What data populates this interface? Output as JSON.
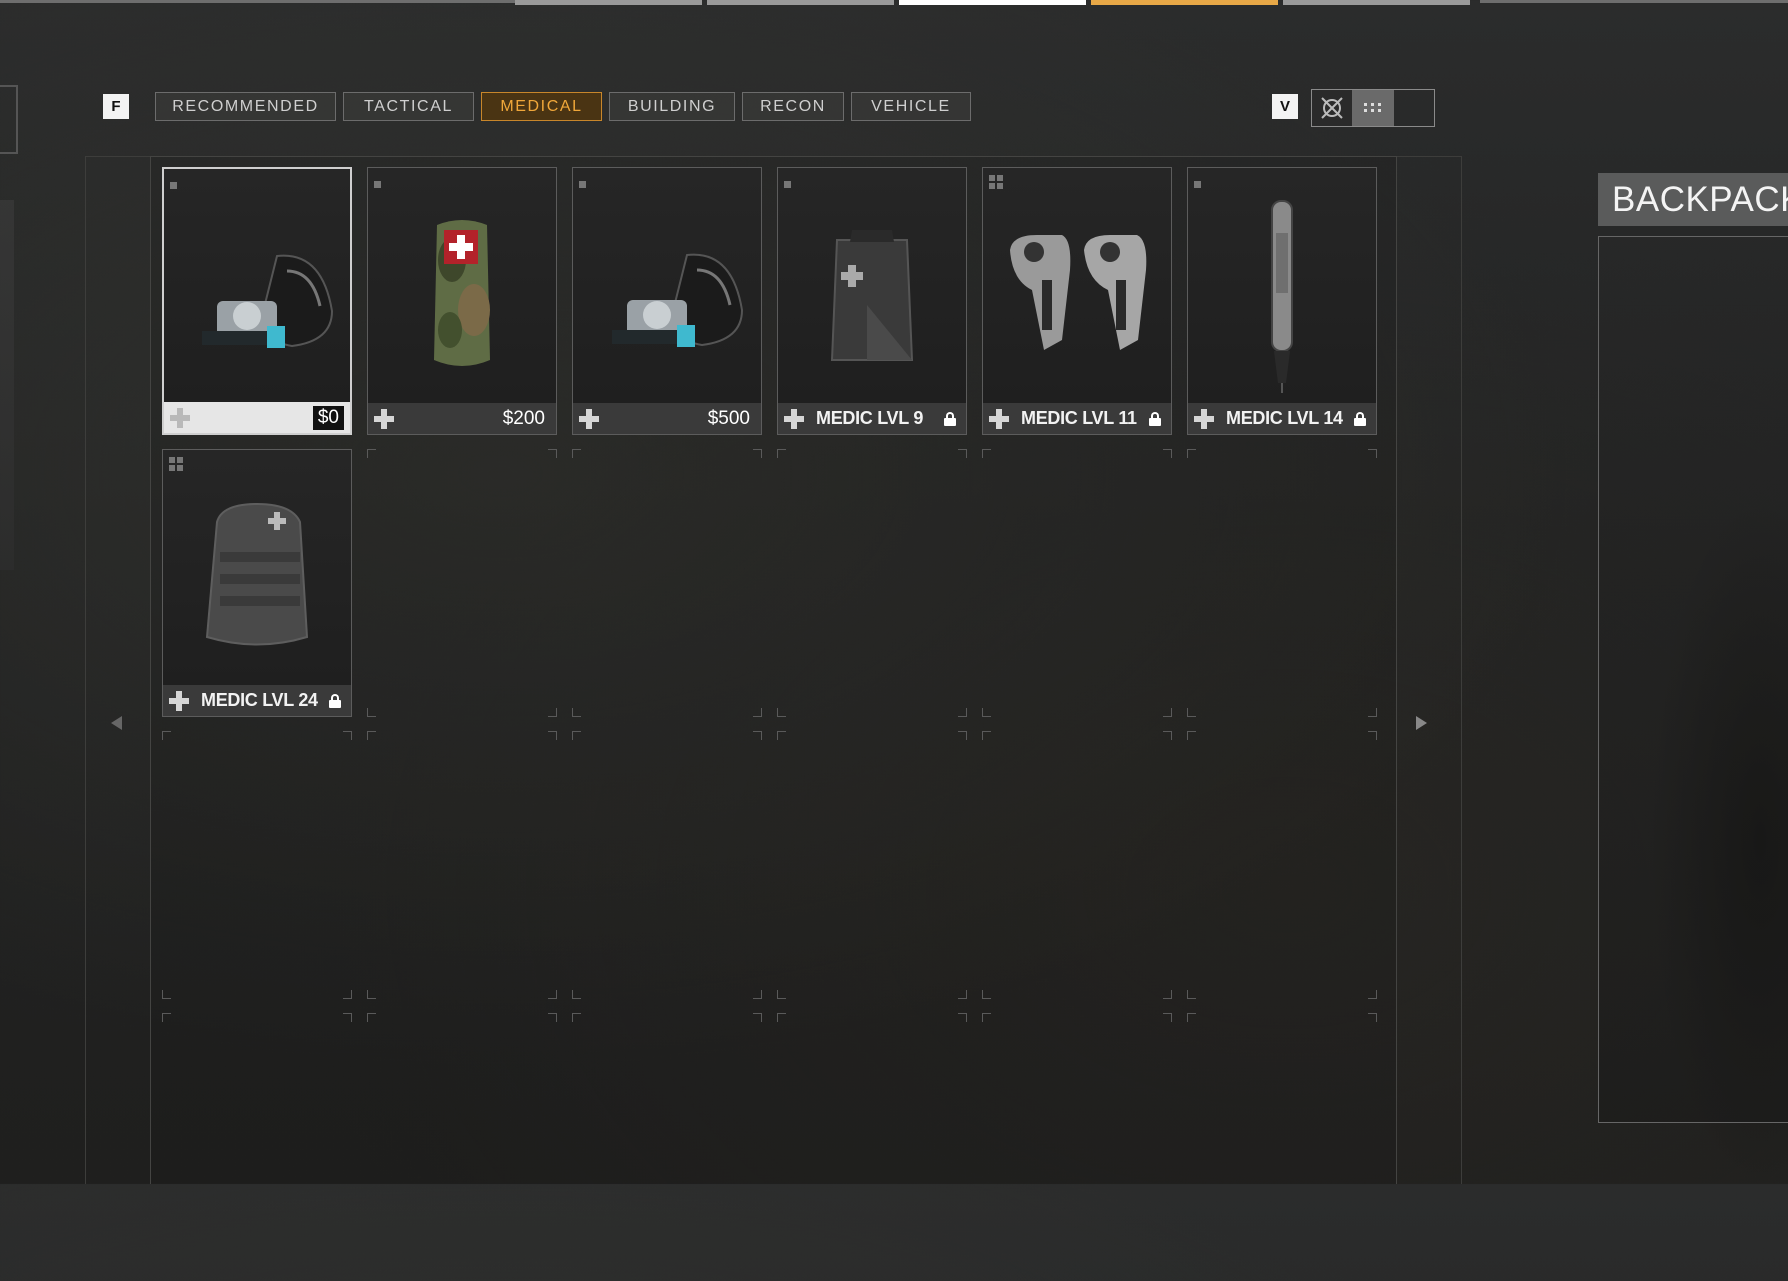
{
  "filter_key": "F",
  "view_key": "V",
  "filters": [
    {
      "label": "RECOMMENDED",
      "active": false
    },
    {
      "label": "TACTICAL",
      "active": false
    },
    {
      "label": "MEDICAL",
      "active": true
    },
    {
      "label": "BUILDING",
      "active": false
    },
    {
      "label": "RECON",
      "active": false
    },
    {
      "label": "VEHICLE",
      "active": false
    }
  ],
  "colors": {
    "accent": "#f0a73a",
    "active_bg": "#4a3413"
  },
  "items": [
    {
      "icon": "gas-mask-icon",
      "label": "$0",
      "kind": "price",
      "selected": true
    },
    {
      "icon": "tourniquet-pouch-icon",
      "label": "$200",
      "kind": "price",
      "selected": false
    },
    {
      "icon": "gas-mask-icon",
      "label": "$500",
      "kind": "price",
      "selected": false
    },
    {
      "icon": "medic-bag-icon",
      "label": "MEDIC LVL 9",
      "kind": "locked",
      "selected": false
    },
    {
      "icon": "defibrillator-icon",
      "label": "MEDIC LVL 11",
      "kind": "locked",
      "selected": false
    },
    {
      "icon": "injector-pen-icon",
      "label": "MEDIC LVL 14",
      "kind": "locked",
      "selected": false
    },
    {
      "icon": "medic-backpack-icon",
      "label": "MEDIC LVL 24",
      "kind": "locked",
      "selected": false
    }
  ],
  "backpack": {
    "title": "BACKPACK"
  }
}
